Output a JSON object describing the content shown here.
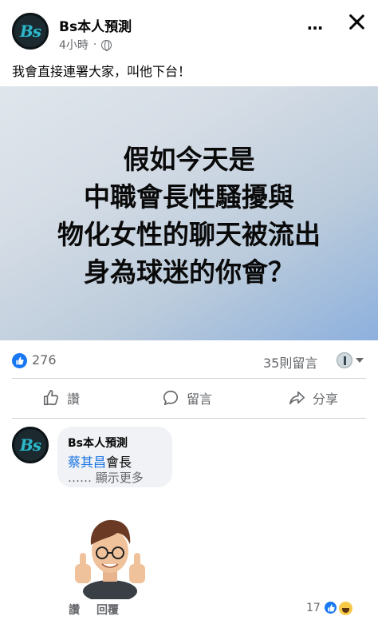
{
  "post": {
    "page_name": "Bs本人預測",
    "time": "4小時",
    "dot": "·",
    "avatar_text": "Bs",
    "more_icon": "…",
    "text": "我會直接連署大家，叫他下台！",
    "image_lines": [
      "假如今天是",
      "中職會長性騷擾與",
      "物化女性的聊天被流出",
      "身為球迷的你會？"
    ]
  },
  "stats": {
    "likes": "276",
    "comments": "35則留言"
  },
  "actions": {
    "like": "讚",
    "comment": "留言",
    "share": "分享"
  },
  "comment": {
    "author": "Bs本人預測",
    "mention": "蔡其昌",
    "mention_rest": "會長",
    "see_more": "…… 顯示更多",
    "like_label": "讚",
    "reply_label": "回覆",
    "reaction_count": "17"
  },
  "colors": {
    "accent": "#1877f2",
    "muted_text": "#65676b",
    "bubble": "#f0f2f5"
  }
}
